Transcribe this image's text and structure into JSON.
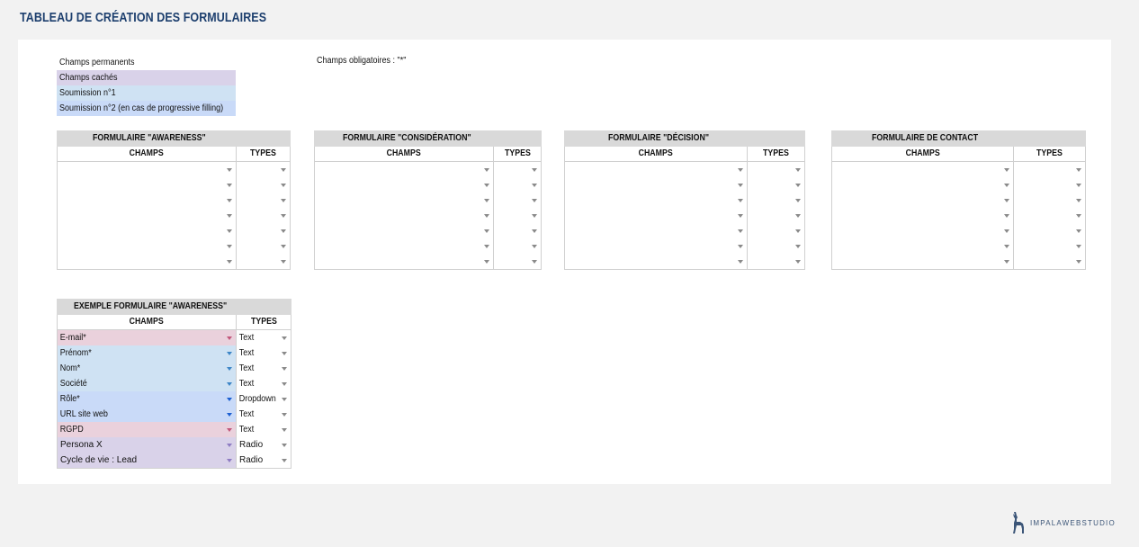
{
  "page": {
    "title": "TABLEAU DE CRÉATION DES FORMULAIRES"
  },
  "legend": {
    "items": [
      {
        "label": "Champs permanents",
        "color": "#ffffff"
      },
      {
        "label": "Champs cachés",
        "color": "#d9d2e9"
      },
      {
        "label": "Soumission n°1",
        "color": "#cfe2f3"
      },
      {
        "label": "Soumission n°2 (en cas de progressive filling)",
        "color": "#c9daf8"
      }
    ]
  },
  "required_note": "Champs obligatoires : \"*\"",
  "column_headers": {
    "fields": "CHAMPS",
    "types": "TYPES"
  },
  "forms": [
    {
      "title": "FORMULAIRE \"AWARENESS\"",
      "rows": 7
    },
    {
      "title": "FORMULAIRE \"CONSIDÉRATION\"",
      "rows": 7
    },
    {
      "title": "FORMULAIRE \"DÉCISION\"",
      "rows": 7
    },
    {
      "title": "FORMULAIRE DE CONTACT",
      "rows": 7
    }
  ],
  "example": {
    "title": "EXEMPLE FORMULAIRE \"AWARENESS\"",
    "rows": [
      {
        "field": "E-mail*",
        "type": "Text",
        "category": "permanent",
        "bg": "#ead1dc",
        "arrow": "#c2577b"
      },
      {
        "field": "Prénom*",
        "type": "Text",
        "category": "soumission-1",
        "bg": "#cfe2f3",
        "arrow": "#3d85c6"
      },
      {
        "field": "Nom*",
        "type": "Text",
        "category": "soumission-1",
        "bg": "#cfe2f3",
        "arrow": "#3d85c6"
      },
      {
        "field": "Société",
        "type": "Text",
        "category": "soumission-1",
        "bg": "#cfe2f3",
        "arrow": "#3d85c6"
      },
      {
        "field": "Rôle*",
        "type": "Dropdown",
        "category": "soumission-2",
        "bg": "#c9daf8",
        "arrow": "#1c5fd1"
      },
      {
        "field": "URL site web",
        "type": "Text",
        "category": "soumission-2",
        "bg": "#c9daf8",
        "arrow": "#1c5fd1"
      },
      {
        "field": "RGPD",
        "type": "Text",
        "category": "permanent",
        "bg": "#ead1dc",
        "arrow": "#c2577b"
      },
      {
        "field": "Persona X",
        "type": "Radio",
        "category": "cache",
        "bg": "#d9d2e9",
        "arrow": "#8e7cc3"
      },
      {
        "field": "Cycle de vie : Lead",
        "type": "Radio",
        "category": "cache",
        "bg": "#d9d2e9",
        "arrow": "#8e7cc3"
      }
    ]
  },
  "logo": {
    "text": "IMPALAWEBSTUDIO",
    "icon": "impala-icon",
    "color": "#3c5678"
  }
}
